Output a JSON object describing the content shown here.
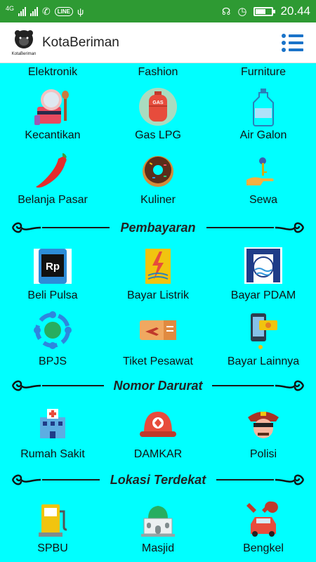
{
  "statusbar": {
    "network": "4G",
    "line_badge": "LINE",
    "time": "20.44"
  },
  "appbar": {
    "title": "KotaBeriman",
    "logo_text": "KotaBeriman"
  },
  "top_row": {
    "labels": [
      "Elektronik",
      "Fashion",
      "Furniture"
    ]
  },
  "services": [
    {
      "label": "Kecantikan",
      "icon": "cosmetics-icon"
    },
    {
      "label": "Gas LPG",
      "icon": "gas-cylinder-icon",
      "icon_text": "GAS"
    },
    {
      "label": "Air Galon",
      "icon": "water-gallon-icon"
    },
    {
      "label": "Belanja Pasar",
      "icon": "chili-icon"
    },
    {
      "label": "Kuliner",
      "icon": "donut-icon"
    },
    {
      "label": "Sewa",
      "icon": "hand-key-icon"
    }
  ],
  "sections": [
    {
      "title": "Pembayaran",
      "items": [
        {
          "label": "Beli Pulsa",
          "icon": "phone-credit-icon",
          "icon_text": "Rp"
        },
        {
          "label": "Bayar Listrik",
          "icon": "electricity-icon"
        },
        {
          "label": "Bayar PDAM",
          "icon": "water-utility-icon"
        },
        {
          "label": "BPJS",
          "icon": "bpjs-icon"
        },
        {
          "label": "Tiket Pesawat",
          "icon": "plane-ticket-icon"
        },
        {
          "label": "Bayar Lainnya",
          "icon": "mobile-payment-icon"
        }
      ]
    },
    {
      "title": "Nomor Darurat",
      "items": [
        {
          "label": "Rumah Sakit",
          "icon": "hospital-icon"
        },
        {
          "label": "DAMKAR",
          "icon": "firefighter-helmet-icon"
        },
        {
          "label": "Polisi",
          "icon": "police-icon"
        }
      ]
    },
    {
      "title": "Lokasi Terdekat",
      "items": [
        {
          "label": "SPBU",
          "icon": "fuel-pump-icon"
        },
        {
          "label": "Masjid",
          "icon": "mosque-icon"
        },
        {
          "label": "Bengkel",
          "icon": "car-repair-icon"
        }
      ]
    }
  ],
  "colors": {
    "statusbar": "#2e9a33",
    "background": "#00FFFF",
    "menu_icon": "#1a73c9"
  }
}
